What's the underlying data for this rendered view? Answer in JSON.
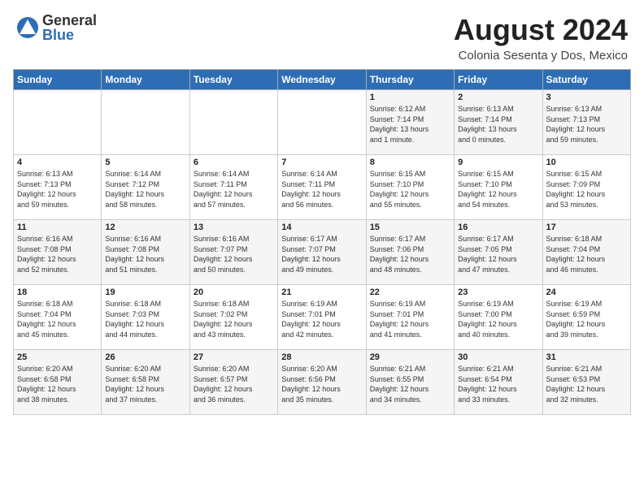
{
  "header": {
    "logo_general": "General",
    "logo_blue": "Blue",
    "month_title": "August 2024",
    "subtitle": "Colonia Sesenta y Dos, Mexico"
  },
  "days_of_week": [
    "Sunday",
    "Monday",
    "Tuesday",
    "Wednesday",
    "Thursday",
    "Friday",
    "Saturday"
  ],
  "weeks": [
    [
      {
        "day": "",
        "info": ""
      },
      {
        "day": "",
        "info": ""
      },
      {
        "day": "",
        "info": ""
      },
      {
        "day": "",
        "info": ""
      },
      {
        "day": "1",
        "info": "Sunrise: 6:12 AM\nSunset: 7:14 PM\nDaylight: 13 hours\nand 1 minute."
      },
      {
        "day": "2",
        "info": "Sunrise: 6:13 AM\nSunset: 7:14 PM\nDaylight: 13 hours\nand 0 minutes."
      },
      {
        "day": "3",
        "info": "Sunrise: 6:13 AM\nSunset: 7:13 PM\nDaylight: 12 hours\nand 59 minutes."
      }
    ],
    [
      {
        "day": "4",
        "info": "Sunrise: 6:13 AM\nSunset: 7:13 PM\nDaylight: 12 hours\nand 59 minutes."
      },
      {
        "day": "5",
        "info": "Sunrise: 6:14 AM\nSunset: 7:12 PM\nDaylight: 12 hours\nand 58 minutes."
      },
      {
        "day": "6",
        "info": "Sunrise: 6:14 AM\nSunset: 7:11 PM\nDaylight: 12 hours\nand 57 minutes."
      },
      {
        "day": "7",
        "info": "Sunrise: 6:14 AM\nSunset: 7:11 PM\nDaylight: 12 hours\nand 56 minutes."
      },
      {
        "day": "8",
        "info": "Sunrise: 6:15 AM\nSunset: 7:10 PM\nDaylight: 12 hours\nand 55 minutes."
      },
      {
        "day": "9",
        "info": "Sunrise: 6:15 AM\nSunset: 7:10 PM\nDaylight: 12 hours\nand 54 minutes."
      },
      {
        "day": "10",
        "info": "Sunrise: 6:15 AM\nSunset: 7:09 PM\nDaylight: 12 hours\nand 53 minutes."
      }
    ],
    [
      {
        "day": "11",
        "info": "Sunrise: 6:16 AM\nSunset: 7:08 PM\nDaylight: 12 hours\nand 52 minutes."
      },
      {
        "day": "12",
        "info": "Sunrise: 6:16 AM\nSunset: 7:08 PM\nDaylight: 12 hours\nand 51 minutes."
      },
      {
        "day": "13",
        "info": "Sunrise: 6:16 AM\nSunset: 7:07 PM\nDaylight: 12 hours\nand 50 minutes."
      },
      {
        "day": "14",
        "info": "Sunrise: 6:17 AM\nSunset: 7:07 PM\nDaylight: 12 hours\nand 49 minutes."
      },
      {
        "day": "15",
        "info": "Sunrise: 6:17 AM\nSunset: 7:06 PM\nDaylight: 12 hours\nand 48 minutes."
      },
      {
        "day": "16",
        "info": "Sunrise: 6:17 AM\nSunset: 7:05 PM\nDaylight: 12 hours\nand 47 minutes."
      },
      {
        "day": "17",
        "info": "Sunrise: 6:18 AM\nSunset: 7:04 PM\nDaylight: 12 hours\nand 46 minutes."
      }
    ],
    [
      {
        "day": "18",
        "info": "Sunrise: 6:18 AM\nSunset: 7:04 PM\nDaylight: 12 hours\nand 45 minutes."
      },
      {
        "day": "19",
        "info": "Sunrise: 6:18 AM\nSunset: 7:03 PM\nDaylight: 12 hours\nand 44 minutes."
      },
      {
        "day": "20",
        "info": "Sunrise: 6:18 AM\nSunset: 7:02 PM\nDaylight: 12 hours\nand 43 minutes."
      },
      {
        "day": "21",
        "info": "Sunrise: 6:19 AM\nSunset: 7:01 PM\nDaylight: 12 hours\nand 42 minutes."
      },
      {
        "day": "22",
        "info": "Sunrise: 6:19 AM\nSunset: 7:01 PM\nDaylight: 12 hours\nand 41 minutes."
      },
      {
        "day": "23",
        "info": "Sunrise: 6:19 AM\nSunset: 7:00 PM\nDaylight: 12 hours\nand 40 minutes."
      },
      {
        "day": "24",
        "info": "Sunrise: 6:19 AM\nSunset: 6:59 PM\nDaylight: 12 hours\nand 39 minutes."
      }
    ],
    [
      {
        "day": "25",
        "info": "Sunrise: 6:20 AM\nSunset: 6:58 PM\nDaylight: 12 hours\nand 38 minutes."
      },
      {
        "day": "26",
        "info": "Sunrise: 6:20 AM\nSunset: 6:58 PM\nDaylight: 12 hours\nand 37 minutes."
      },
      {
        "day": "27",
        "info": "Sunrise: 6:20 AM\nSunset: 6:57 PM\nDaylight: 12 hours\nand 36 minutes."
      },
      {
        "day": "28",
        "info": "Sunrise: 6:20 AM\nSunset: 6:56 PM\nDaylight: 12 hours\nand 35 minutes."
      },
      {
        "day": "29",
        "info": "Sunrise: 6:21 AM\nSunset: 6:55 PM\nDaylight: 12 hours\nand 34 minutes."
      },
      {
        "day": "30",
        "info": "Sunrise: 6:21 AM\nSunset: 6:54 PM\nDaylight: 12 hours\nand 33 minutes."
      },
      {
        "day": "31",
        "info": "Sunrise: 6:21 AM\nSunset: 6:53 PM\nDaylight: 12 hours\nand 32 minutes."
      }
    ]
  ]
}
